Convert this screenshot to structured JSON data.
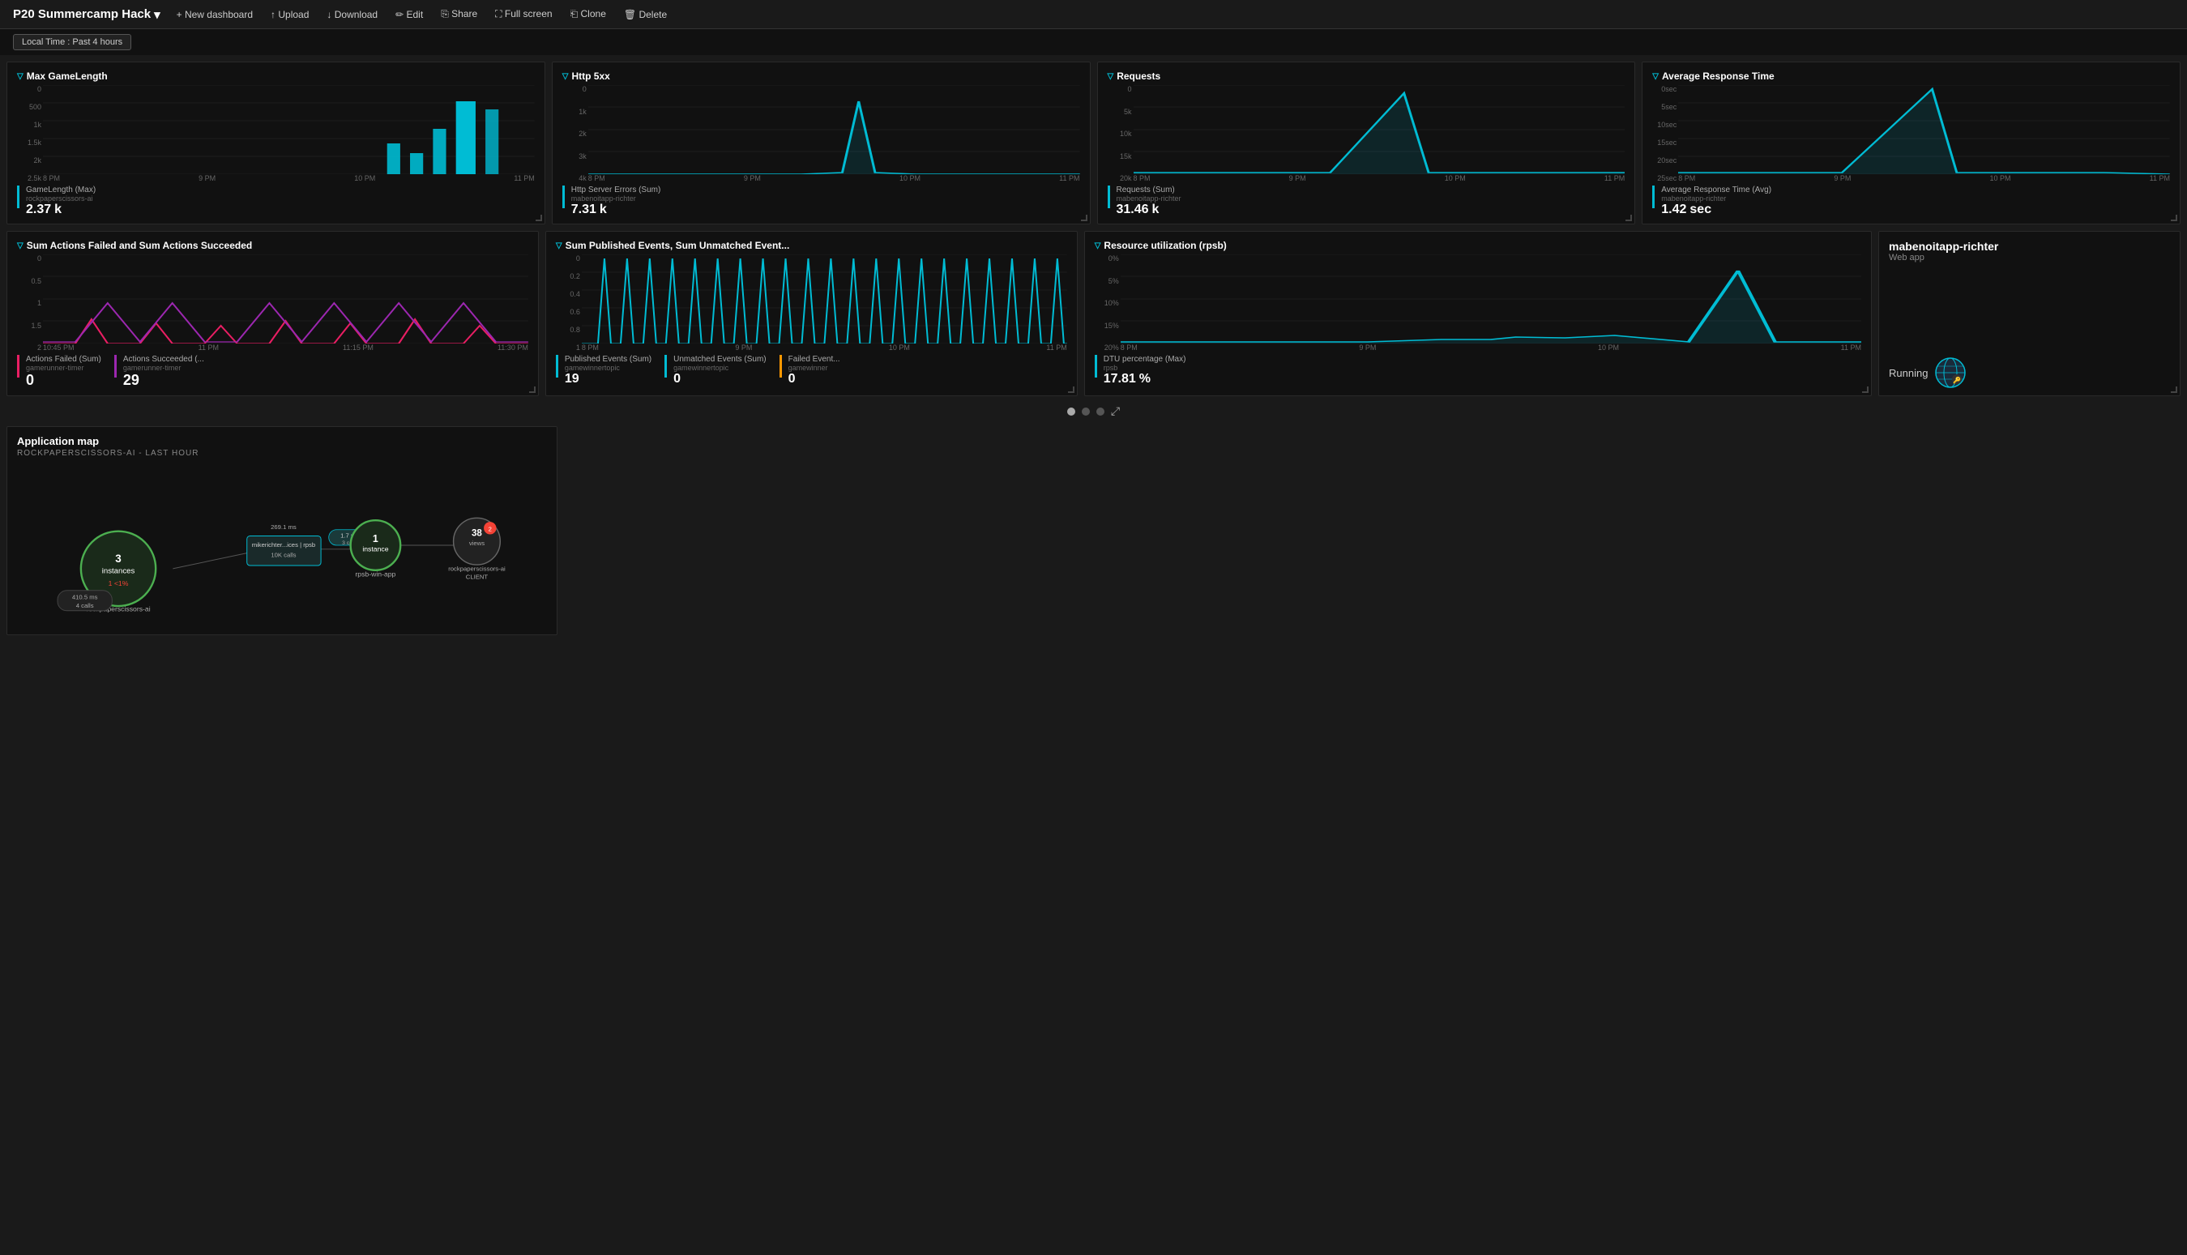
{
  "app": {
    "title": "P20 Summercamp Hack",
    "chevron": "▾"
  },
  "topbar": {
    "new_dashboard": "+ New dashboard",
    "upload": "↑ Upload",
    "download": "↓ Download",
    "edit": "✏ Edit",
    "share": "⎘ Share",
    "fullscreen": "⛶ Full screen",
    "clone": "⎗ Clone",
    "delete": "🗑 Delete"
  },
  "timebar": {
    "label": "Local Time : Past 4 hours"
  },
  "widgets": {
    "max_game_length": {
      "title": "Max GameLength",
      "y_labels": [
        "2.5k",
        "2k",
        "1.5k",
        "1k",
        "500",
        "0"
      ],
      "x_labels": [
        "8 PM",
        "9 PM",
        "10 PM",
        "11 PM"
      ],
      "legend_name": "GameLength (Max)",
      "legend_source": "rockpaperscissors-ai",
      "legend_value": "2.37",
      "legend_unit": "k",
      "bar_color": "#00bcd4"
    },
    "http_5xx": {
      "title": "Http 5xx",
      "y_labels": [
        "4k",
        "3k",
        "2k",
        "1k",
        "0"
      ],
      "x_labels": [
        "8 PM",
        "9 PM",
        "10 PM",
        "11 PM"
      ],
      "legend_name": "Http Server Errors (Sum)",
      "legend_source": "mabenoitapp-richter",
      "legend_value": "7.31",
      "legend_unit": "k",
      "line_color": "#00bcd4"
    },
    "requests": {
      "title": "Requests",
      "y_labels": [
        "20k",
        "15k",
        "10k",
        "5k",
        "0"
      ],
      "x_labels": [
        "8 PM",
        "9 PM",
        "10 PM",
        "11 PM"
      ],
      "legend_name": "Requests (Sum)",
      "legend_source": "mabenoitapp-richter",
      "legend_value": "31.46",
      "legend_unit": "k",
      "line_color": "#00bcd4"
    },
    "avg_response_time": {
      "title": "Average Response Time",
      "y_labels": [
        "25sec",
        "20sec",
        "15sec",
        "10sec",
        "5sec",
        "0sec"
      ],
      "x_labels": [
        "8 PM",
        "9 PM",
        "10 PM",
        "11 PM"
      ],
      "legend_name": "Average Response Time (Avg)",
      "legend_source": "mabenoitapp-richter",
      "legend_value": "1.42",
      "legend_unit": "sec",
      "line_color": "#00bcd4"
    },
    "sum_actions": {
      "title": "Sum Actions Failed and Sum Actions Succeeded",
      "y_labels": [
        "2",
        "1.5",
        "1",
        "0.5",
        "0"
      ],
      "x_labels": [
        "10:45 PM",
        "11 PM",
        "11:15 PM",
        "11:30 PM"
      ],
      "legend1_name": "Actions Failed (Sum)",
      "legend1_source": "gamerunner-timer",
      "legend1_value": "0",
      "legend1_color": "#e91e63",
      "legend2_name": "Actions Succeeded (...",
      "legend2_source": "gamerunner-timer",
      "legend2_value": "29",
      "legend2_color": "#9c27b0"
    },
    "sum_published": {
      "title": "Sum Published Events, Sum Unmatched Event...",
      "y_labels": [
        "1",
        "0.8",
        "0.6",
        "0.4",
        "0.2",
        "0"
      ],
      "x_labels": [
        "8 PM",
        "9 PM",
        "10 PM",
        "11 PM"
      ],
      "legend1_name": "Published Events (Sum)",
      "legend1_source": "gamewinnertopic",
      "legend1_value": "19",
      "legend1_color": "#00bcd4",
      "legend2_name": "Unmatched Events (Sum)",
      "legend2_source": "gamewinnertopic",
      "legend2_value": "0",
      "legend2_color": "#00bcd4",
      "legend3_name": "Failed Event...",
      "legend3_source": "gamewinner",
      "legend3_value": "0",
      "legend3_color": "#ff9800"
    },
    "resource_util": {
      "title": "Resource utilization (rpsb)",
      "y_labels": [
        "20%",
        "15%",
        "10%",
        "5%",
        "0%"
      ],
      "x_labels": [
        "8 PM",
        "9 PM",
        "10 PM",
        "11 PM"
      ],
      "legend_name": "DTU percentage (Max)",
      "legend_source": "rpsb",
      "legend_value": "17.81",
      "legend_unit": "%",
      "line_color": "#00bcd4"
    },
    "app_info": {
      "name": "mabenoitapp-richter",
      "type": "Web app",
      "status": "Running"
    }
  },
  "appmap": {
    "title": "Application map",
    "subtitle": "ROCKPAPERSCISSORS-AI - LAST HOUR",
    "nodes": {
      "main": {
        "label": "rockpaperscissors-ai",
        "instances": "3\ninstances",
        "error": "1 <1%"
      },
      "middle": {
        "label": "mikerichter...ices | rpsb",
        "calls": "10K calls",
        "ms": "269.1 ms"
      },
      "win_app": {
        "label": "rpsb-win-app",
        "instances": "1\ninstance"
      },
      "client": {
        "label": "rockpaperscissors-ai\nCLIENT",
        "views": "38\nviews"
      }
    },
    "connections": {
      "main_to_middle": "410.5 ms\n4 calls",
      "middle_to_winapp": "1.7 ms\n3 calls",
      "winapp_to_client_views": "2"
    }
  },
  "pagination": {
    "dots": [
      true,
      false,
      false
    ],
    "expand_icon": "⤢"
  }
}
